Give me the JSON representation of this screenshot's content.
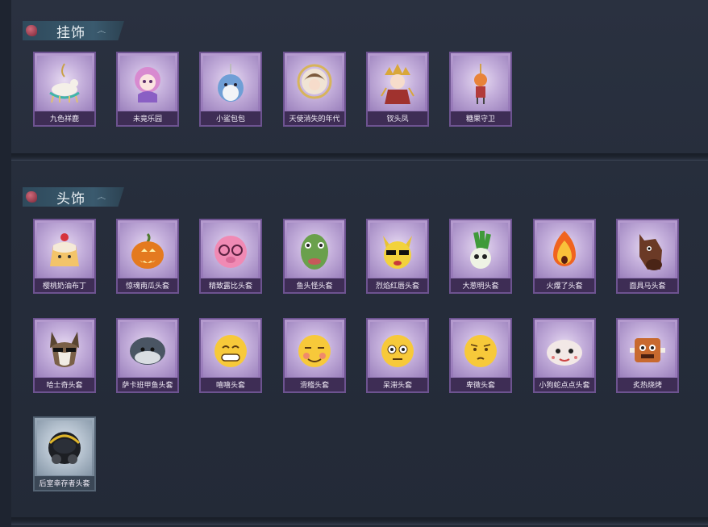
{
  "sections": {
    "pendants": {
      "title": "挂饰",
      "items": [
        {
          "label": "九色祥鹿",
          "icon": "deer-pendant-icon"
        },
        {
          "label": "未竟乐园",
          "icon": "girl-doll-pendant-icon"
        },
        {
          "label": "小鲨包包",
          "icon": "shark-pendant-icon"
        },
        {
          "label": "天使消失的年代",
          "icon": "angel-portrait-pendant-icon"
        },
        {
          "label": "钗头凤",
          "icon": "phoenix-doll-pendant-icon"
        },
        {
          "label": "糖果守卫",
          "icon": "candy-guard-pendant-icon"
        }
      ]
    },
    "headwear": {
      "title": "头饰",
      "items": [
        {
          "label": "樱桃奶油布丁",
          "icon": "pudding-head-icon"
        },
        {
          "label": "惊魂南瓜头套",
          "icon": "pumpkin-head-icon"
        },
        {
          "label": "精致露比头套",
          "icon": "pink-pig-head-icon"
        },
        {
          "label": "鱼头怪头套",
          "icon": "fish-head-icon"
        },
        {
          "label": "烈焰红唇头套",
          "icon": "yellow-mouse-head-icon"
        },
        {
          "label": "大葱明头套",
          "icon": "scallion-head-icon"
        },
        {
          "label": "火爆了头套",
          "icon": "fire-head-icon"
        },
        {
          "label": "面具马头套",
          "icon": "horse-head-icon"
        },
        {
          "label": "哈士奇头套",
          "icon": "husky-head-icon"
        },
        {
          "label": "萨卡班甲鱼头套",
          "icon": "sacabambaspis-head-icon"
        },
        {
          "label": "嘻嘻头套",
          "icon": "grin-emoji-head-icon"
        },
        {
          "label": "滑稽头套",
          "icon": "funny-emoji-head-icon"
        },
        {
          "label": "呆滞头套",
          "icon": "dazed-emoji-head-icon"
        },
        {
          "label": "卑微头套",
          "icon": "humble-emoji-head-icon"
        },
        {
          "label": "小狗蛇点点头套",
          "icon": "dog-snake-head-icon"
        },
        {
          "label": "炙热烧烤",
          "icon": "toast-head-icon"
        },
        {
          "label": "后室幸存者头套",
          "icon": "gas-mask-helmet-icon",
          "rarity": "grey"
        }
      ]
    }
  },
  "colors": {
    "purple_card": "#9a7dbf",
    "grey_card": "#8393a4",
    "background": "#252c39"
  }
}
